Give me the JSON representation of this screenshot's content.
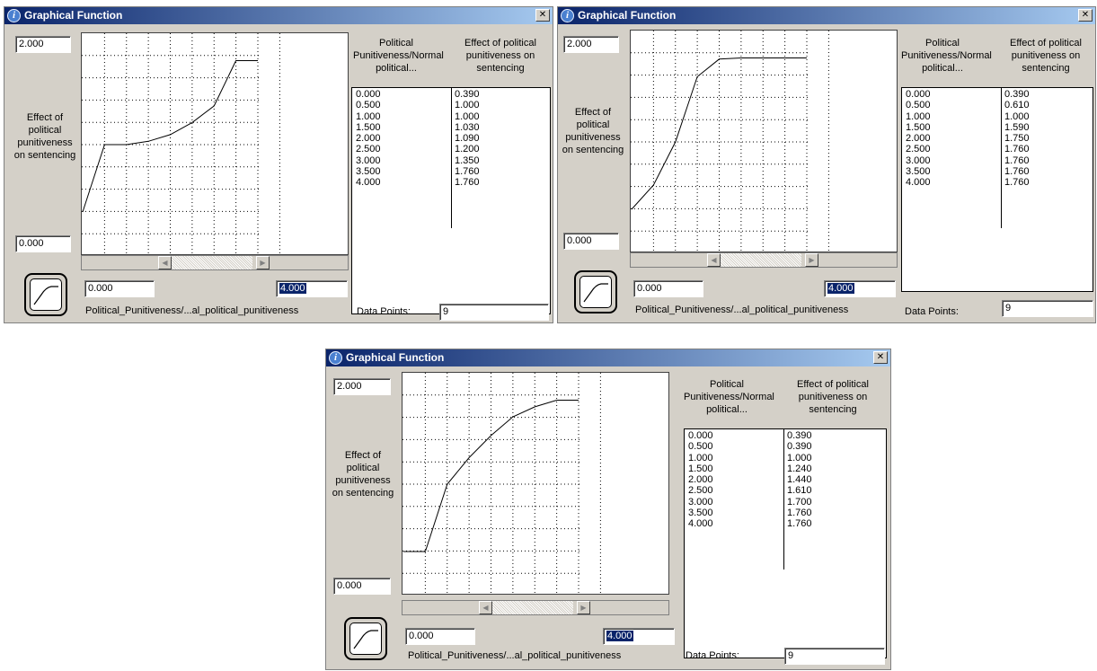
{
  "windows": [
    {
      "title": "Graphical Function",
      "y_max": "2.000",
      "y_min": "0.000",
      "y_label": "Effect of political punitiveness on sentencing",
      "x_min": "0.000",
      "x_max": "4.000",
      "x_label": "Political_Punitiveness/...al_political_punitiveness",
      "table_header_input": "Political Punitiveness/Normal political...",
      "table_header_output": "Effect of political punitiveness on sentencing",
      "inputs": [
        "0.000",
        "0.500",
        "1.000",
        "1.500",
        "2.000",
        "2.500",
        "3.000",
        "3.500",
        "4.000"
      ],
      "outputs": [
        "0.390",
        "1.000",
        "1.000",
        "1.030",
        "1.090",
        "1.200",
        "1.350",
        "1.760",
        "1.760"
      ],
      "data_points_label": "Data Points:",
      "data_points": "9"
    },
    {
      "title": "Graphical Function",
      "y_max": "2.000",
      "y_min": "0.000",
      "y_label": "Effect of political punitiveness on sentencing",
      "x_min": "0.000",
      "x_max": "4.000",
      "x_label": "Political_Punitiveness/...al_political_punitiveness",
      "table_header_input": "Political Punitiveness/Normal political...",
      "table_header_output": "Effect of political punitiveness on sentencing",
      "inputs": [
        "0.000",
        "0.500",
        "1.000",
        "1.500",
        "2.000",
        "2.500",
        "3.000",
        "3.500",
        "4.000"
      ],
      "outputs": [
        "0.390",
        "0.610",
        "1.000",
        "1.590",
        "1.750",
        "1.760",
        "1.760",
        "1.760",
        "1.760"
      ],
      "data_points_label": "Data Points:",
      "data_points": "9"
    },
    {
      "title": "Graphical Function",
      "y_max": "2.000",
      "y_min": "0.000",
      "y_label": "Effect of political punitiveness on sentencing",
      "x_min": "0.000",
      "x_max": "4.000",
      "x_label": "Political_Punitiveness/...al_political_punitiveness",
      "table_header_input": "Political Punitiveness/Normal political...",
      "table_header_output": "Effect of political punitiveness on sentencing",
      "inputs": [
        "0.000",
        "0.500",
        "1.000",
        "1.500",
        "2.000",
        "2.500",
        "3.000",
        "3.500",
        "4.000"
      ],
      "outputs": [
        "0.390",
        "0.390",
        "1.000",
        "1.240",
        "1.440",
        "1.610",
        "1.700",
        "1.760",
        "1.760"
      ],
      "data_points_label": "Data Points:",
      "data_points": "9"
    }
  ],
  "chart_data": [
    {
      "type": "line",
      "x": [
        0,
        0.5,
        1,
        1.5,
        2,
        2.5,
        3,
        3.5,
        4
      ],
      "y": [
        0.39,
        1.0,
        1.0,
        1.03,
        1.09,
        1.2,
        1.35,
        1.76,
        1.76
      ],
      "xlim": [
        0,
        4
      ],
      "ylim": [
        0,
        2
      ],
      "grid": true
    },
    {
      "type": "line",
      "x": [
        0,
        0.5,
        1,
        1.5,
        2,
        2.5,
        3,
        3.5,
        4
      ],
      "y": [
        0.39,
        0.61,
        1.0,
        1.59,
        1.75,
        1.76,
        1.76,
        1.76,
        1.76
      ],
      "xlim": [
        0,
        4
      ],
      "ylim": [
        0,
        2
      ],
      "grid": true
    },
    {
      "type": "line",
      "x": [
        0,
        0.5,
        1,
        1.5,
        2,
        2.5,
        3,
        3.5,
        4
      ],
      "y": [
        0.39,
        0.39,
        1.0,
        1.24,
        1.44,
        1.61,
        1.7,
        1.76,
        1.76
      ],
      "xlim": [
        0,
        4
      ],
      "ylim": [
        0,
        2
      ],
      "grid": true
    }
  ]
}
